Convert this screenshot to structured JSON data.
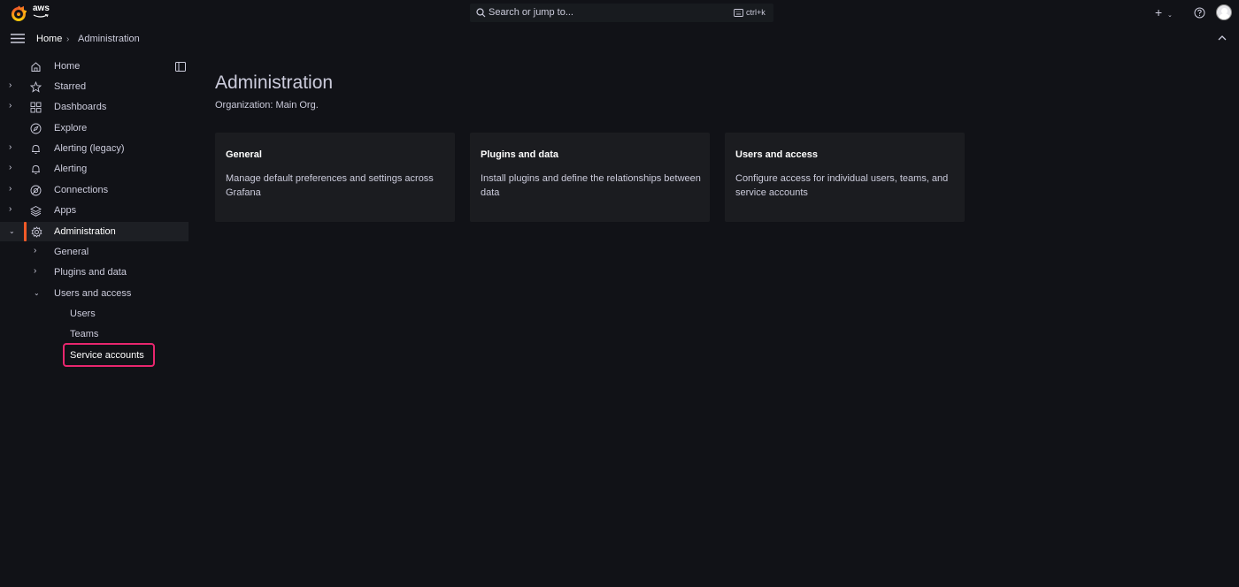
{
  "header": {
    "brand_text": "aws",
    "search_placeholder": "Search or jump to...",
    "search_shortcut": "ctrl+k"
  },
  "breadcrumb": {
    "home": "Home",
    "separator": "›",
    "current": "Administration"
  },
  "sidebar": {
    "items": [
      {
        "label": "Home",
        "icon": "home-icon",
        "expandable": false
      },
      {
        "label": "Starred",
        "icon": "star-icon",
        "expandable": true
      },
      {
        "label": "Dashboards",
        "icon": "grid-icon",
        "expandable": true
      },
      {
        "label": "Explore",
        "icon": "compass-icon",
        "expandable": false
      },
      {
        "label": "Alerting (legacy)",
        "icon": "bell-icon",
        "expandable": true
      },
      {
        "label": "Alerting",
        "icon": "bell-icon",
        "expandable": true
      },
      {
        "label": "Connections",
        "icon": "link-icon",
        "expandable": true
      },
      {
        "label": "Apps",
        "icon": "layers-icon",
        "expandable": true
      },
      {
        "label": "Administration",
        "icon": "gear-icon",
        "expandable": true,
        "active": true
      }
    ],
    "admin_children": [
      {
        "label": "General"
      },
      {
        "label": "Plugins and data"
      },
      {
        "label": "Users and access"
      }
    ],
    "users_access_children": [
      {
        "label": "Users"
      },
      {
        "label": "Teams"
      },
      {
        "label": "Service accounts"
      }
    ]
  },
  "main": {
    "title": "Administration",
    "subtitle": "Organization: Main Org.",
    "cards": [
      {
        "title": "General",
        "description": "Manage default preferences and settings across Grafana"
      },
      {
        "title": "Plugins and data",
        "description": "Install plugins and define the relationships between data"
      },
      {
        "title": "Users and access",
        "description": "Configure access for individual users, teams, and service accounts"
      }
    ]
  },
  "colors": {
    "background": "#111217",
    "accent": "#f05a28",
    "highlight": "#e8266e"
  }
}
